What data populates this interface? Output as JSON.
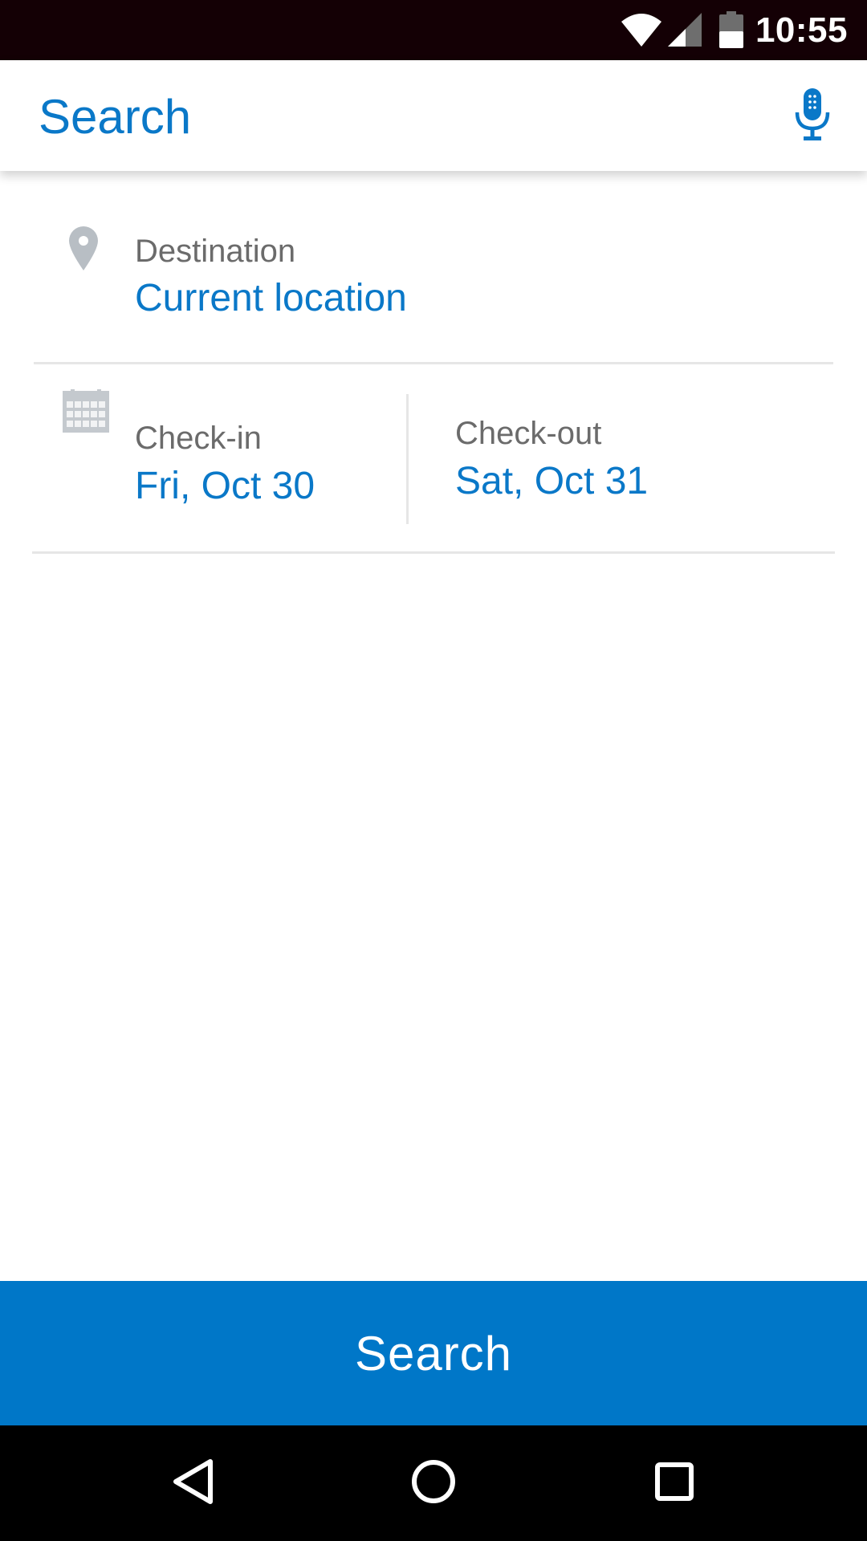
{
  "status_bar": {
    "time": "10:55",
    "icons": [
      "wifi-icon",
      "cell-signal-icon",
      "battery-icon"
    ]
  },
  "app_bar": {
    "title": "Search",
    "mic_icon": "microphone-icon"
  },
  "destination": {
    "icon": "location-pin-icon",
    "label": "Destination",
    "value": "Current location"
  },
  "dates": {
    "icon": "calendar-icon",
    "checkin_label": "Check-in",
    "checkin_value": "Fri, Oct 30",
    "checkout_label": "Check-out",
    "checkout_value": "Sat, Oct 31"
  },
  "search_button": {
    "label": "Search"
  },
  "nav_bar": {
    "icons": [
      "back-icon",
      "home-icon",
      "recents-icon"
    ]
  },
  "colors": {
    "accent": "#0077c8",
    "link_text": "#0a78c8",
    "label_text": "#6b6b6b",
    "status_bar_bg": "#140005",
    "icon_gray": "#b8bec4"
  }
}
